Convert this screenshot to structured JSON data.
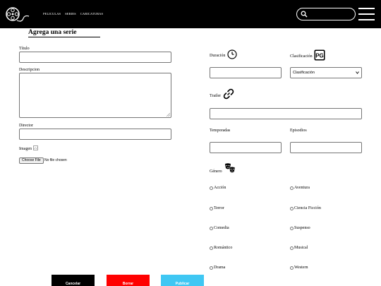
{
  "nav": {
    "items": [
      "PELICULAS",
      "SERIES",
      "CARICATURAS"
    ]
  },
  "form": {
    "title": "Agrega una serie",
    "titulo_label": "Título",
    "descripcion_label": "Descripcion",
    "director_label": "Director",
    "imagen_label": "Imagen",
    "file_button_label": "Choose File",
    "file_status": "No file chosen",
    "duracion_label": "Duración",
    "clasificacion_label": "Clasificación",
    "clasificacion_selected": "Clasificación",
    "trailer_label": "Trailer",
    "temporadas_label": "Temporadas",
    "episodios_label": "Episodios",
    "genero_label": "Género",
    "genres": [
      "Acción",
      "Aventura",
      "Terror",
      "Ciencia Ficción",
      "Comedia",
      "Suspenso",
      "Romántico",
      "Musical",
      "Drama",
      "Western"
    ]
  },
  "buttons": {
    "cancel": "Cancelar",
    "delete": "Borrar",
    "publish": "Publicar"
  },
  "colors": {
    "header_bg": "#000000",
    "cancel_bg": "#000000",
    "delete_bg": "#ff0000",
    "publish_bg": "#3fc7f3"
  },
  "icons": {
    "logo": "film-reel-logo-icon",
    "search": "search-icon",
    "menu": "hamburger-menu-icon",
    "duracion": "clock-icon",
    "clasificacion": "pg-rating-icon",
    "trailer": "link-icon",
    "genero": "theater-masks-icon",
    "imagen": "broken-image-icon"
  }
}
